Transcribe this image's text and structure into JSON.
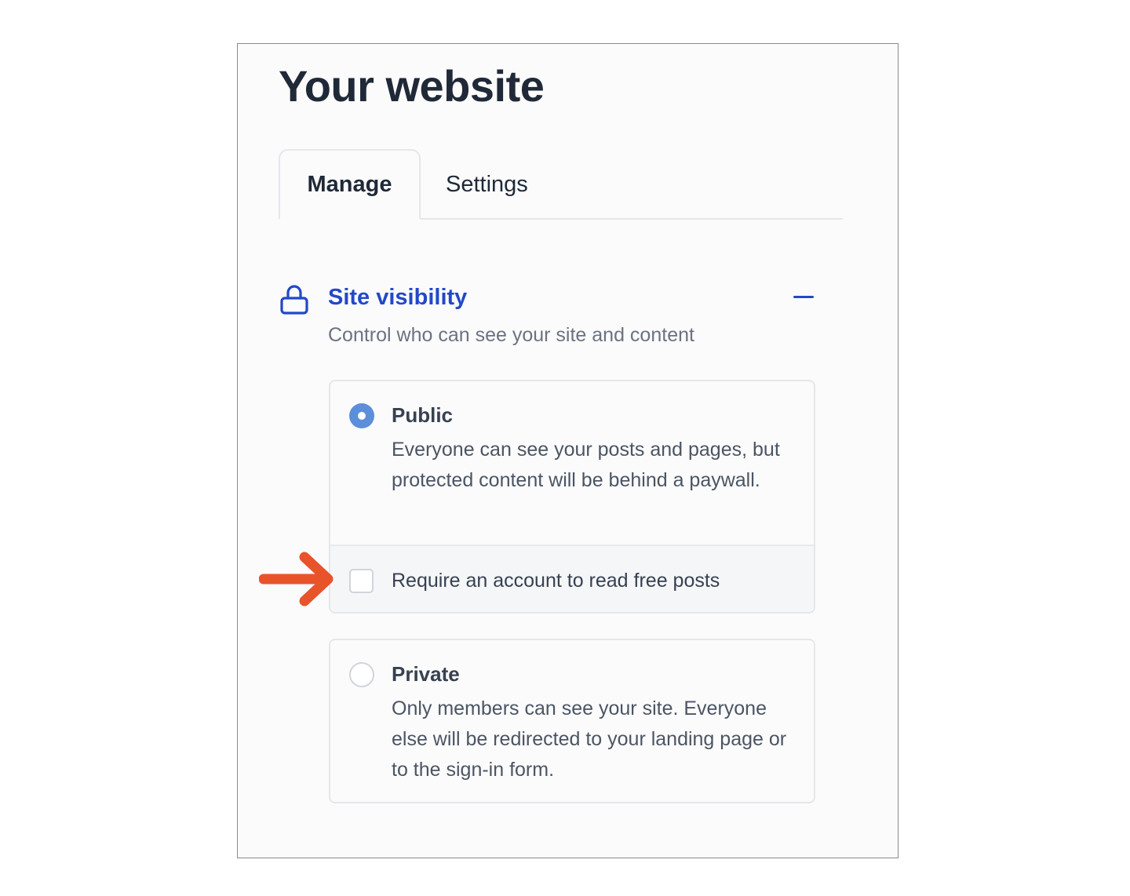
{
  "page": {
    "title": "Your website"
  },
  "tabs": [
    {
      "label": "Manage",
      "active": true
    },
    {
      "label": "Settings",
      "active": false
    }
  ],
  "section": {
    "icon": "lock-icon",
    "title": "Site visibility",
    "description": "Control who can see your site and content",
    "toggle_icon": "minus-icon",
    "expanded": true
  },
  "options": {
    "public": {
      "label": "Public",
      "description": "Everyone can see your posts and pages, but protected content will be behind a paywall.",
      "selected": true,
      "sub_option": {
        "label": "Require an account to read free posts",
        "checked": false
      }
    },
    "private": {
      "label": "Private",
      "description": "Only members can see your site. Everyone else will be redirected to your landing page or to the sign-in form.",
      "selected": false
    }
  },
  "annotation": {
    "icon": "arrow-right-icon",
    "color": "#e8532a"
  },
  "colors": {
    "accent": "#2348c8",
    "radio_selected": "#5b8fd9",
    "title_text": "#1f2937"
  }
}
